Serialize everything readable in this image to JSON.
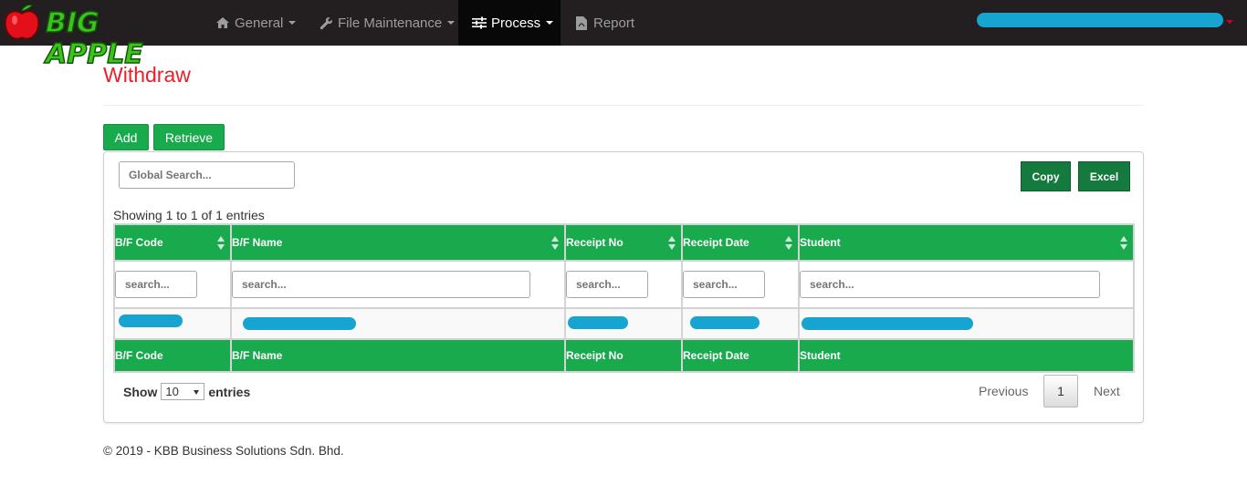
{
  "brand": {
    "name": "BIG APPLE"
  },
  "nav": {
    "general": "General",
    "file_maintenance": "File Maintenance",
    "process": "Process",
    "report": "Report"
  },
  "page": {
    "title": "Withdraw",
    "add_label": "Add",
    "retrieve_label": "Retrieve"
  },
  "toolbar": {
    "global_search_placeholder": "Global Search...",
    "copy_label": "Copy",
    "excel_label": "Excel"
  },
  "table": {
    "info": "Showing 1 to 1 of 1 entries",
    "columns": [
      "B/F Code",
      "B/F Name",
      "Receipt No",
      "Receipt Date",
      "Student"
    ],
    "search_placeholder": "search...",
    "footer_columns": [
      "B/F Code",
      "B/F Name",
      "Receipt No",
      "Receipt Date",
      "Student"
    ]
  },
  "length": {
    "show": "Show",
    "value": "10",
    "entries": "entries"
  },
  "pagination": {
    "previous": "Previous",
    "page": "1",
    "next": "Next"
  },
  "footer": {
    "text": "© 2019 - KBB Business Solutions Sdn. Bhd."
  },
  "colors": {
    "navbar": "#231f20",
    "accent_green": "#1aaa4e",
    "title_red": "#e8202a",
    "redaction": "#17a4d0"
  }
}
